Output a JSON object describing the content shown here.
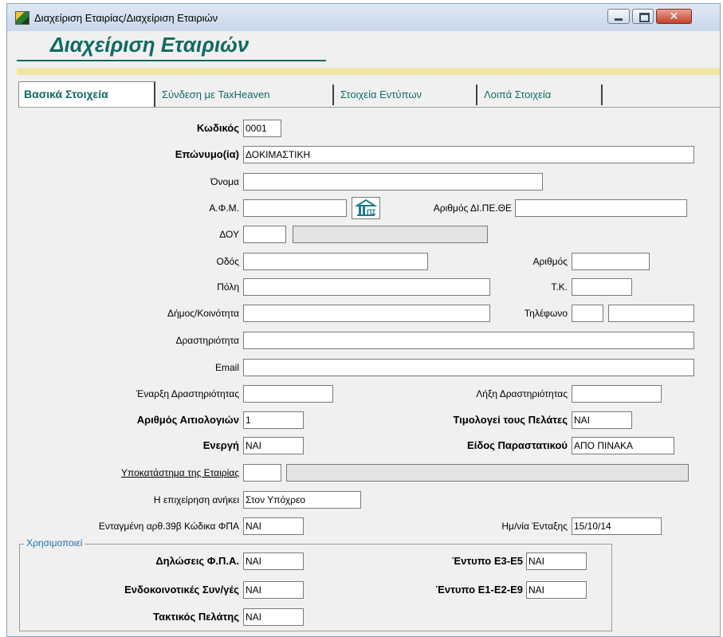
{
  "window": {
    "title": "Διαχείριση Εταιρίας/Διαχείριση Εταιριών",
    "close_glyph": "✕"
  },
  "header": {
    "title": "Διαχείριση Εταιριών"
  },
  "tabs": [
    {
      "label": "Βασικά Στοιχεία",
      "active": true
    },
    {
      "label": "Σύνδεση με TaxHeaven",
      "active": false
    },
    {
      "label": "Στοιχεία Εντύπων",
      "active": false
    },
    {
      "label": "Λοιπά Στοιχεία",
      "active": false
    }
  ],
  "form": {
    "code": {
      "label": "Κωδικός",
      "value": "0001"
    },
    "surname": {
      "label": "Επώνυμο(ία)",
      "value": "ΔΟΚΙΜΑΣΤΙΚΗ"
    },
    "name": {
      "label": "Όνομα",
      "value": ""
    },
    "afm": {
      "label": "Α.Φ.Μ.",
      "value": ""
    },
    "dipethe": {
      "label": "Αριθμός ΔΙ.ΠΕ.ΘΕ",
      "value": ""
    },
    "doy": {
      "label": "ΔΟΥ",
      "code": "",
      "name": ""
    },
    "street": {
      "label": "Οδός",
      "value": ""
    },
    "number": {
      "label": "Αριθμός",
      "value": ""
    },
    "city": {
      "label": "Πόλη",
      "value": ""
    },
    "postcode": {
      "label": "Τ.Κ.",
      "value": ""
    },
    "municipality": {
      "label": "Δήμος/Κοινότητα",
      "value": ""
    },
    "phone": {
      "label": "Τηλέφωνο",
      "prefix": "",
      "value": ""
    },
    "activity": {
      "label": "Δραστηριότητα",
      "value": ""
    },
    "email": {
      "label": "Email",
      "value": ""
    },
    "start_activity": {
      "label": "Έναρξη Δραστηριότητας",
      "value": ""
    },
    "end_activity": {
      "label": "Λήξη Δραστηριότητας",
      "value": ""
    },
    "invoice_count": {
      "label": "Αριθμός Αιτιολογιών",
      "value": "1"
    },
    "invoices_customers": {
      "label": "Τιμολογεί τους Πελάτες",
      "value": "ΝΑΙ"
    },
    "active": {
      "label": "Ενεργή",
      "value": "ΝΑΙ"
    },
    "document_type": {
      "label": "Είδος Παραστατικού",
      "value": "ΑΠΟ ΠΙΝΑΚΑ"
    },
    "branch": {
      "label": "Υποκατάστημα της Εταιρίας",
      "code": "",
      "name": ""
    },
    "belongs_to": {
      "label": "Η επιχείρηση ανήκει",
      "value": "Στον Υπόχρεο"
    },
    "art39b": {
      "label": "Ενταγμένη αρθ.39β Κώδικα ΦΠΑ",
      "value": "ΝΑΙ"
    },
    "inclusion_date": {
      "label": "Ημ/νία Ένταξης",
      "value": "15/10/14"
    }
  },
  "uses": {
    "title": "Χρησιμοποιεί",
    "vat_returns": {
      "label": "Δηλώσεις Φ.Π.Α.",
      "value": "ΝΑΙ"
    },
    "e3e5": {
      "label": "Έντυπο Ε3-Ε5",
      "value": "ΝΑΙ"
    },
    "intra_community": {
      "label": "Ενδοκοινοτικές Συν/γές",
      "value": "ΝΑΙ"
    },
    "e1e2e9": {
      "label": "Έντυπο Ε1-Ε2-Ε9",
      "value": "ΝΑΙ"
    },
    "regular_customer": {
      "label": "Τακτικός Πελάτης",
      "value": "ΝΑΙ"
    }
  },
  "icons": {
    "app": "app-logo-icon",
    "afm_lookup": "taxisnet-lookup-icon"
  },
  "colors": {
    "header_text": "#0f6a63",
    "tab_text": "#0f6a63",
    "band": "#efe6a5",
    "group_title": "#1f6fa8"
  }
}
